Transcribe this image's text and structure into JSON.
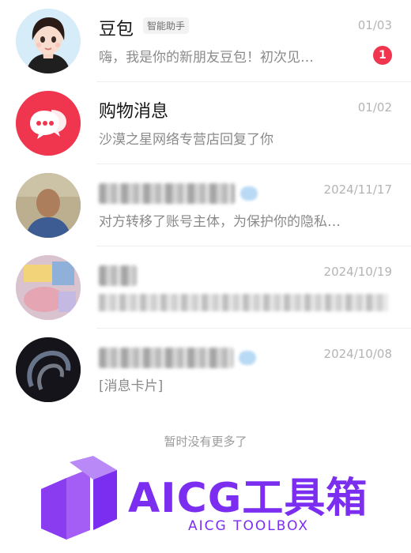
{
  "conversations": [
    {
      "name": "豆包",
      "tag": "智能助手",
      "date": "01/03",
      "preview": "嗨，我是你的新朋友豆包！初次见…",
      "unread": "1",
      "avatar": "girl-avatar"
    },
    {
      "name": "购物消息",
      "date": "01/02",
      "preview": "沙漠之星网络专营店回复了你",
      "avatar": "chat-bubble-icon",
      "avatar_color": "#f0364f"
    },
    {
      "name": "",
      "date": "2024/11/17",
      "preview": "对方转移了账号主体，为保护你的隐私…",
      "avatar": "blurred-avatar"
    },
    {
      "name": "",
      "date": "2024/10/19",
      "preview": "",
      "avatar": "blurred-avatar"
    },
    {
      "name": "",
      "date": "2024/10/08",
      "preview": "[消息卡片]",
      "avatar": "blurred-avatar"
    }
  ],
  "footer": {
    "text": "暂时没有更多了"
  },
  "watermark": {
    "title": "AICG工具箱",
    "subtitle": "AICG TOOLBOX",
    "color": "#7b2ef0"
  },
  "colors": {
    "badge": "#f0364f",
    "date": "#b4b4b4",
    "preview": "#8a8a8a"
  }
}
